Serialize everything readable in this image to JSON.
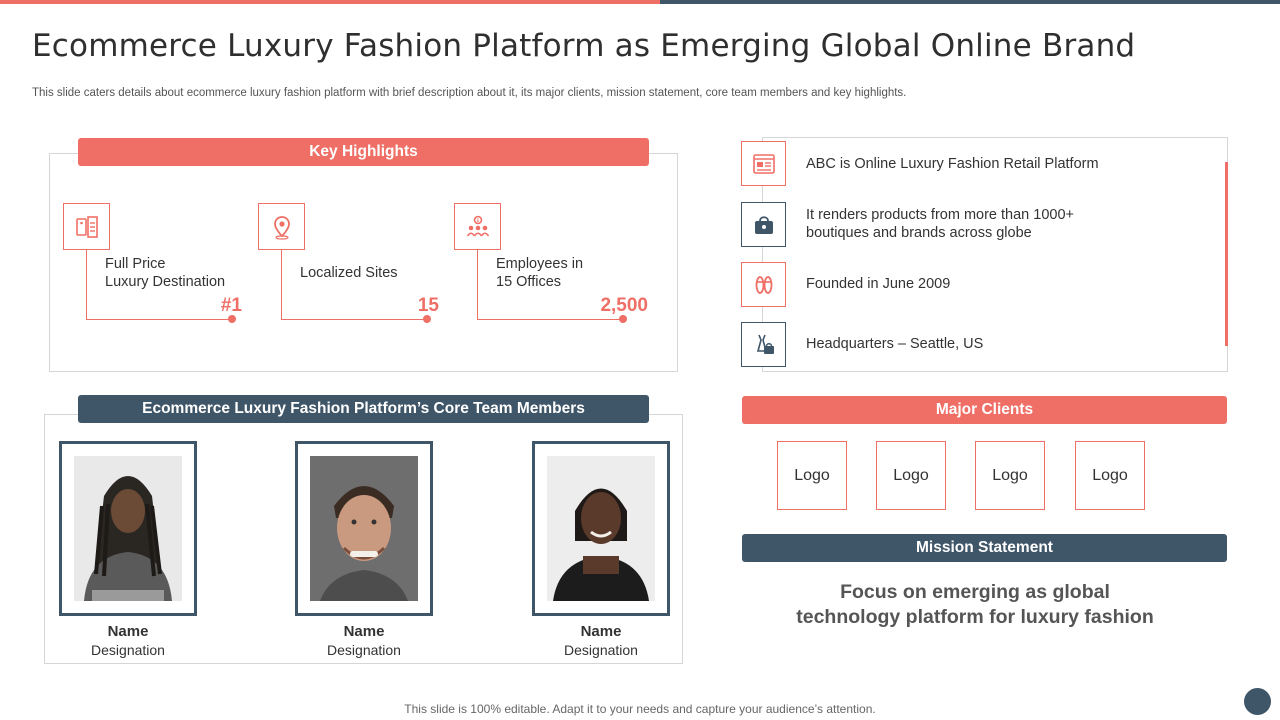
{
  "title": "Ecommerce Luxury Fashion Platform as Emerging Global Online Brand",
  "subtitle": "This slide caters details about ecommerce luxury fashion platform with brief description about it, its major clients, mission statement, core team members and key highlights.",
  "key_highlights": {
    "heading": "Key Highlights",
    "items": [
      {
        "icon": "price-tag-icon",
        "line1": "Full Price",
        "line2": "Luxury Destination",
        "value": "#1"
      },
      {
        "icon": "location-pin-icon",
        "line1": "Localized Sites",
        "line2": "",
        "value": "15"
      },
      {
        "icon": "employees-icon",
        "line1": "Employees in",
        "line2": "15 Offices",
        "value": "2,500"
      }
    ]
  },
  "info": {
    "items": [
      {
        "icon": "browser-window-icon",
        "line1": "ABC is Online Luxury Fashion Retail Platform",
        "line2": ""
      },
      {
        "icon": "shopping-bag-icon",
        "line1": "It renders products from more than 1000+",
        "line2": "boutiques and brands across globe"
      },
      {
        "icon": "sandals-icon",
        "line1": "Founded in June 2009",
        "line2": ""
      },
      {
        "icon": "dress-icon",
        "line1": "Headquarters – Seattle, US",
        "line2": ""
      }
    ]
  },
  "team": {
    "heading": "Ecommerce Luxury Fashion Platform’s Core Team Members",
    "members": [
      {
        "name": "Name",
        "designation": "Designation"
      },
      {
        "name": "Name",
        "designation": "Designation"
      },
      {
        "name": "Name",
        "designation": "Designation"
      }
    ]
  },
  "clients": {
    "heading": "Major Clients",
    "logos": [
      "Logo",
      "Logo",
      "Logo",
      "Logo"
    ]
  },
  "mission": {
    "heading": "Mission Statement",
    "line1": "Focus on emerging as global",
    "line2": "technology platform for luxury fashion"
  },
  "footer": "This slide is 100% editable. Adapt it to your needs and capture your audience’s attention.",
  "colors": {
    "accent": "#ef6f66",
    "navy": "#3f5568"
  }
}
